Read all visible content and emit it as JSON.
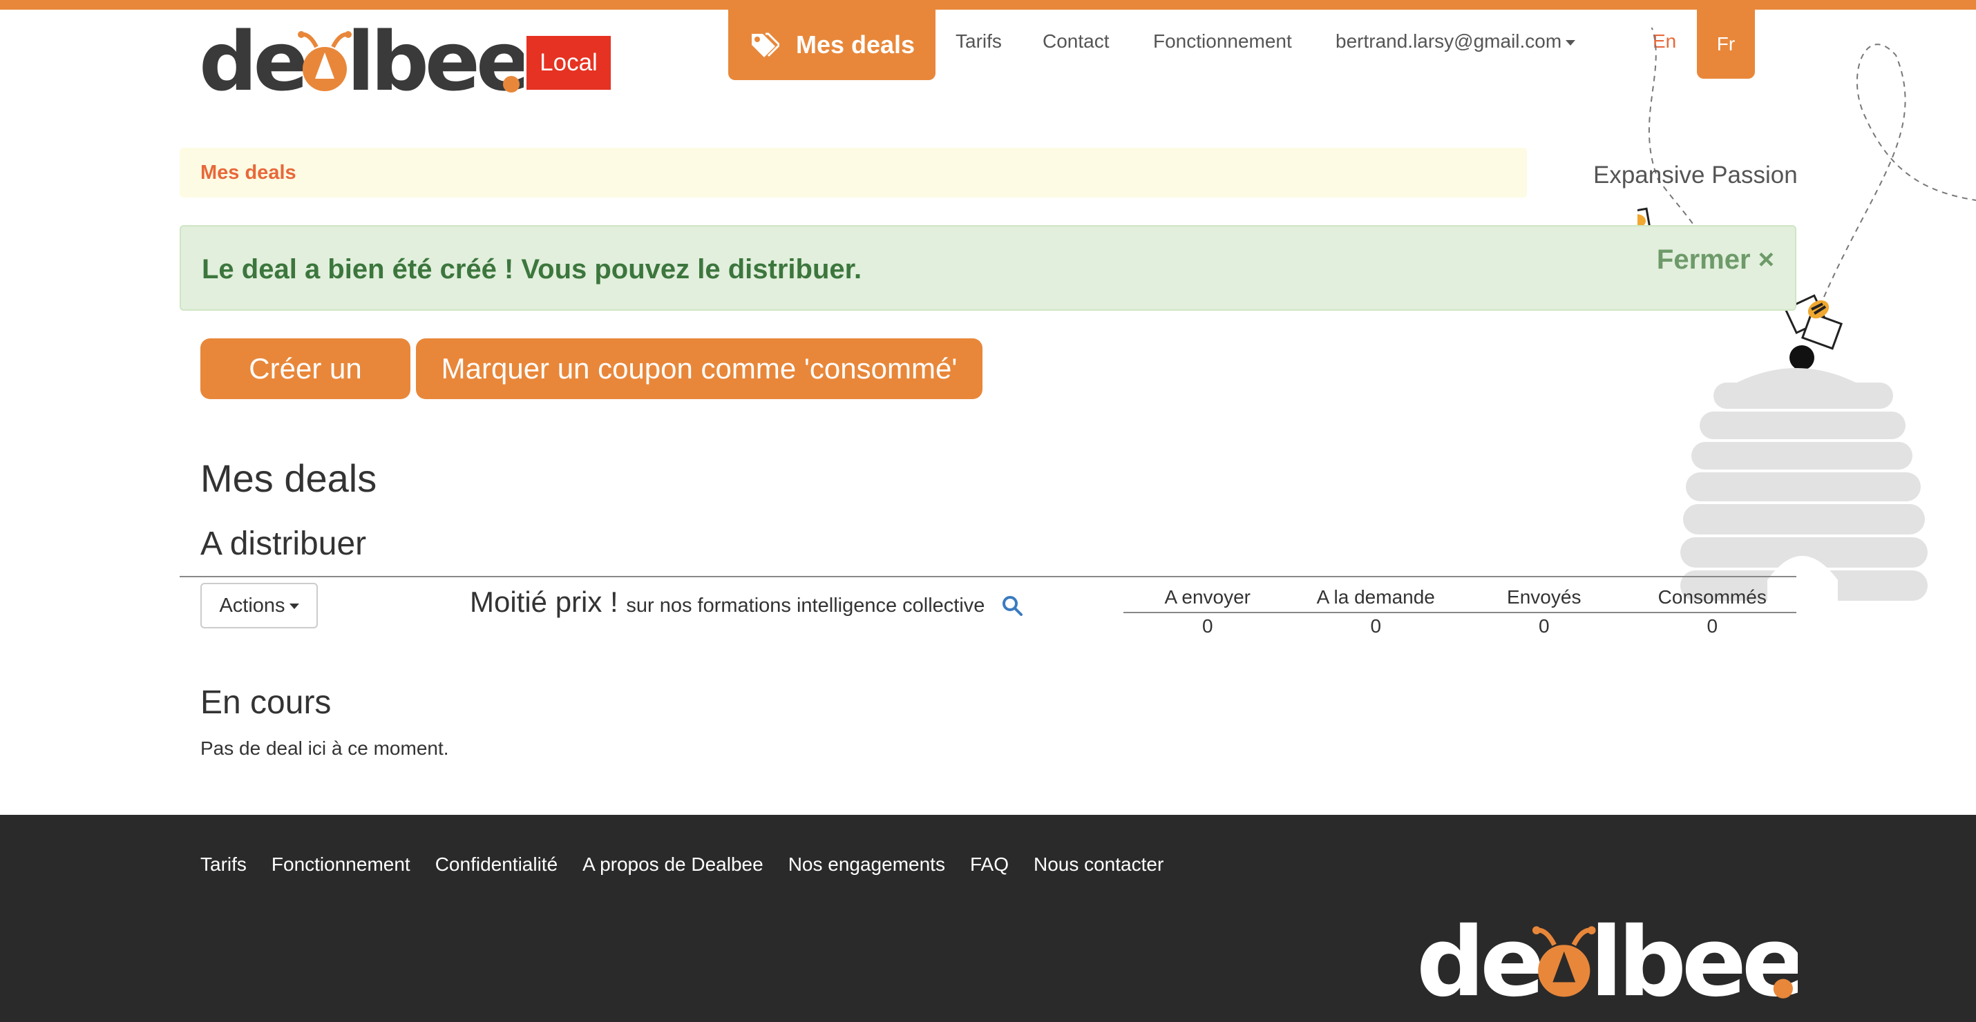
{
  "header": {
    "logo_text": "dealbee.",
    "badge": "Local",
    "nav": {
      "deals": "Mes deals",
      "tarifs": "Tarifs",
      "contact": "Contact",
      "fonctionnement": "Fonctionnement",
      "user": "bertrand.larsy@gmail.com",
      "lang_en": "En",
      "lang_fr": "Fr"
    }
  },
  "breadcrumb": "Mes deals",
  "company": "Expansive Passion",
  "alert": {
    "message": "Le deal a bien été créé ! Vous pouvez le distribuer.",
    "close_label": "Fermer ×"
  },
  "buttons": {
    "create": "Créer un deal",
    "mark_consumed": "Marquer un coupon comme 'consommé'"
  },
  "headings": {
    "my_deals": "Mes deals",
    "to_distribute": "A distribuer",
    "in_progress": "En cours"
  },
  "deal": {
    "actions_label": "Actions",
    "title": "Moitié prix !",
    "subtitle": "sur nos formations intelligence collective",
    "stats": [
      {
        "label": "A envoyer",
        "value": "0"
      },
      {
        "label": "A la demande",
        "value": "0"
      },
      {
        "label": "Envoyés",
        "value": "0"
      },
      {
        "label": "Consommés",
        "value": "0"
      }
    ]
  },
  "empty_text": "Pas de deal ici à ce moment.",
  "footer": {
    "links": [
      "Tarifs",
      "Fonctionnement",
      "Confidentialité",
      "A propos de Dealbee",
      "Nos engagements",
      "FAQ",
      "Nous contacter"
    ],
    "logo_text": "dealbee."
  },
  "colors": {
    "brand_orange": "#e8873a",
    "local_red": "#e63222",
    "alert_green": "#3c763d",
    "alert_bg": "#e1efdc",
    "footer_bg": "#2b2a2a"
  },
  "icons": [
    "tag-icon",
    "search-icon",
    "caret-down-icon",
    "bee-icon",
    "beehive-illustration"
  ]
}
